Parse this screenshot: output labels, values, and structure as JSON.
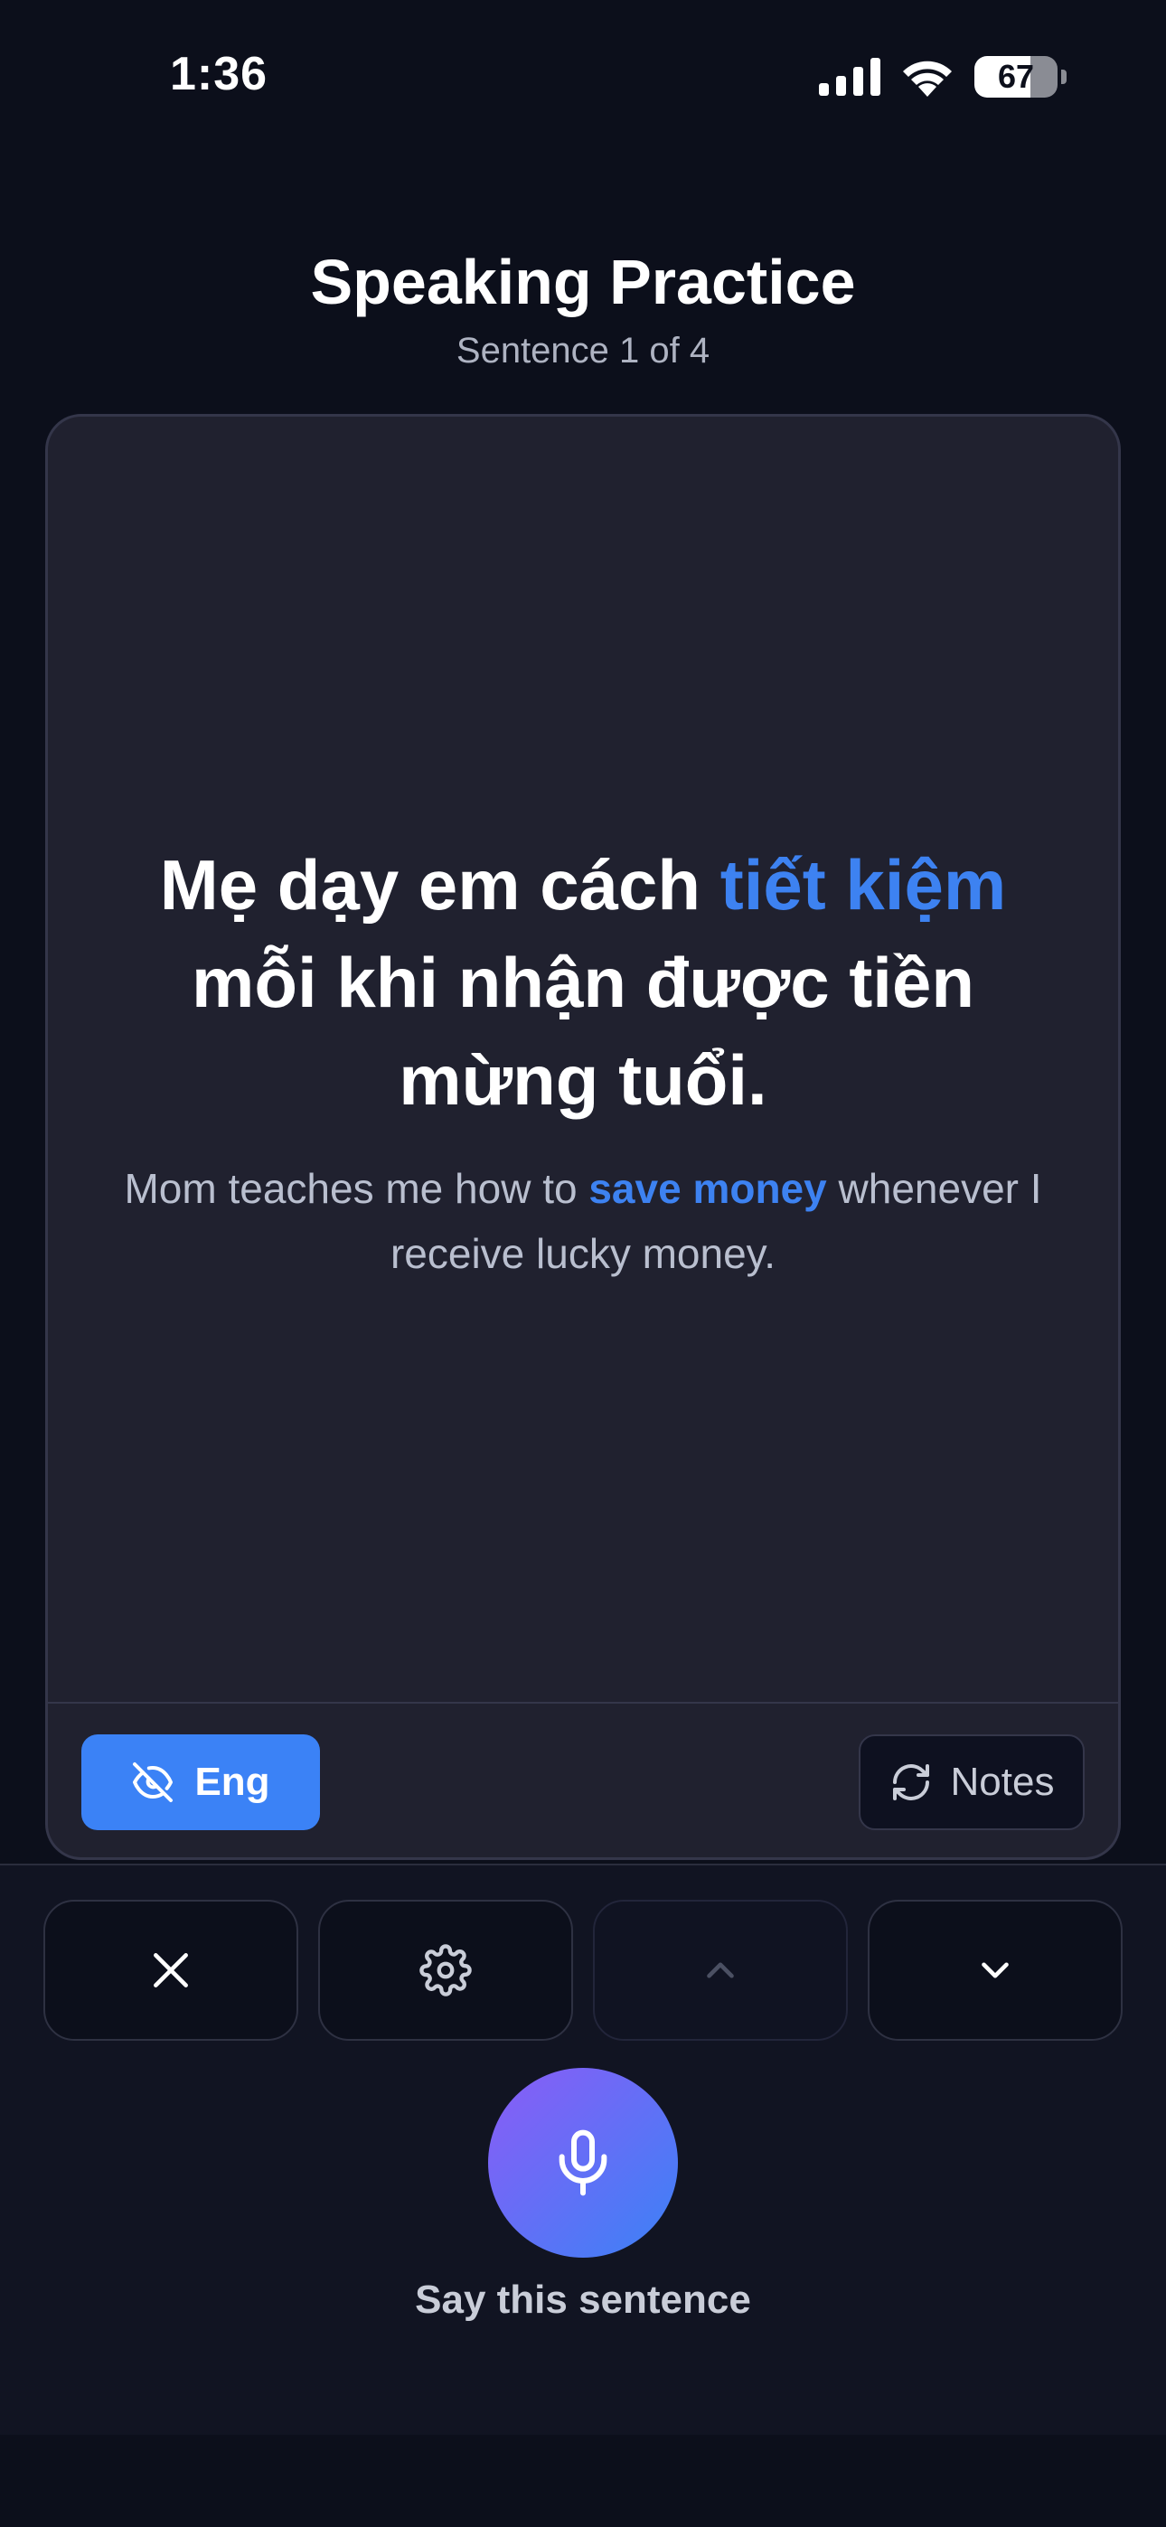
{
  "status_bar": {
    "time": "1:36",
    "battery_level": "67",
    "battery_fraction": 0.67
  },
  "header": {
    "title": "Speaking Practice",
    "subtitle": "Sentence 1 of 4"
  },
  "card": {
    "vietnamese": {
      "before": "Mẹ dạy em cách ",
      "highlight": "tiết kiệm",
      "after": " mỗi khi nhận được tiền mừng tuổi."
    },
    "english": {
      "before": "Mom teaches me how to ",
      "highlight": "save money",
      "after": " whenever I receive lucky money."
    },
    "eng_button_label": "Eng",
    "notes_button_label": "Notes"
  },
  "controls": {
    "close_icon": "close-icon",
    "settings_icon": "gear-icon",
    "up_icon": "chevron-up-icon",
    "down_icon": "chevron-down-icon",
    "mic_label": "Say this sentence"
  },
  "colors": {
    "background": "#0c0f1b",
    "card": "#20212f",
    "accent": "#3b82f6",
    "mic_gradient_start": "#8b5cf6",
    "mic_gradient_end": "#3b82f6"
  }
}
